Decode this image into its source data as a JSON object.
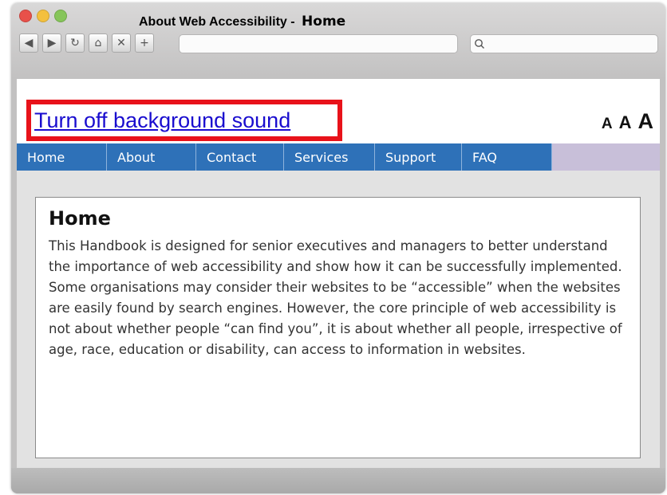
{
  "window": {
    "title_prefix": "About Web Accessibility -",
    "title_page": "Home"
  },
  "toolbar": {
    "buttons": [
      {
        "name": "back-icon",
        "glyph": "◀"
      },
      {
        "name": "forward-icon",
        "glyph": "▶"
      },
      {
        "name": "reload-icon",
        "glyph": "C"
      },
      {
        "name": "home-icon",
        "glyph": "⌂"
      },
      {
        "name": "close-icon",
        "glyph": "✕"
      },
      {
        "name": "new-tab-icon",
        "glyph": "+"
      }
    ]
  },
  "header": {
    "sound_link": "Turn off background sound",
    "text_sizes": [
      "A",
      "A",
      "A"
    ]
  },
  "nav": {
    "items": [
      {
        "label": "Home"
      },
      {
        "label": "About"
      },
      {
        "label": "Contact"
      },
      {
        "label": "Services"
      },
      {
        "label": "Support"
      },
      {
        "label": "FAQ"
      }
    ]
  },
  "main": {
    "heading": "Home",
    "body": "This Handbook is designed for senior executives and managers to better understand the importance of web accessibility and show how it can be successfully implemented. Some organisations may consider their websites to be “accessible” when the websites are easily found by search engines. However, the core principle of web accessibility is not about whether people “can find you”, it is about whether all people, irrespective of age, race, education or disability, can access to information in websites."
  },
  "colors": {
    "link_highlight": "#e8121a",
    "nav_blue": "#2e71b8",
    "link_blue": "#1a0dcf"
  }
}
